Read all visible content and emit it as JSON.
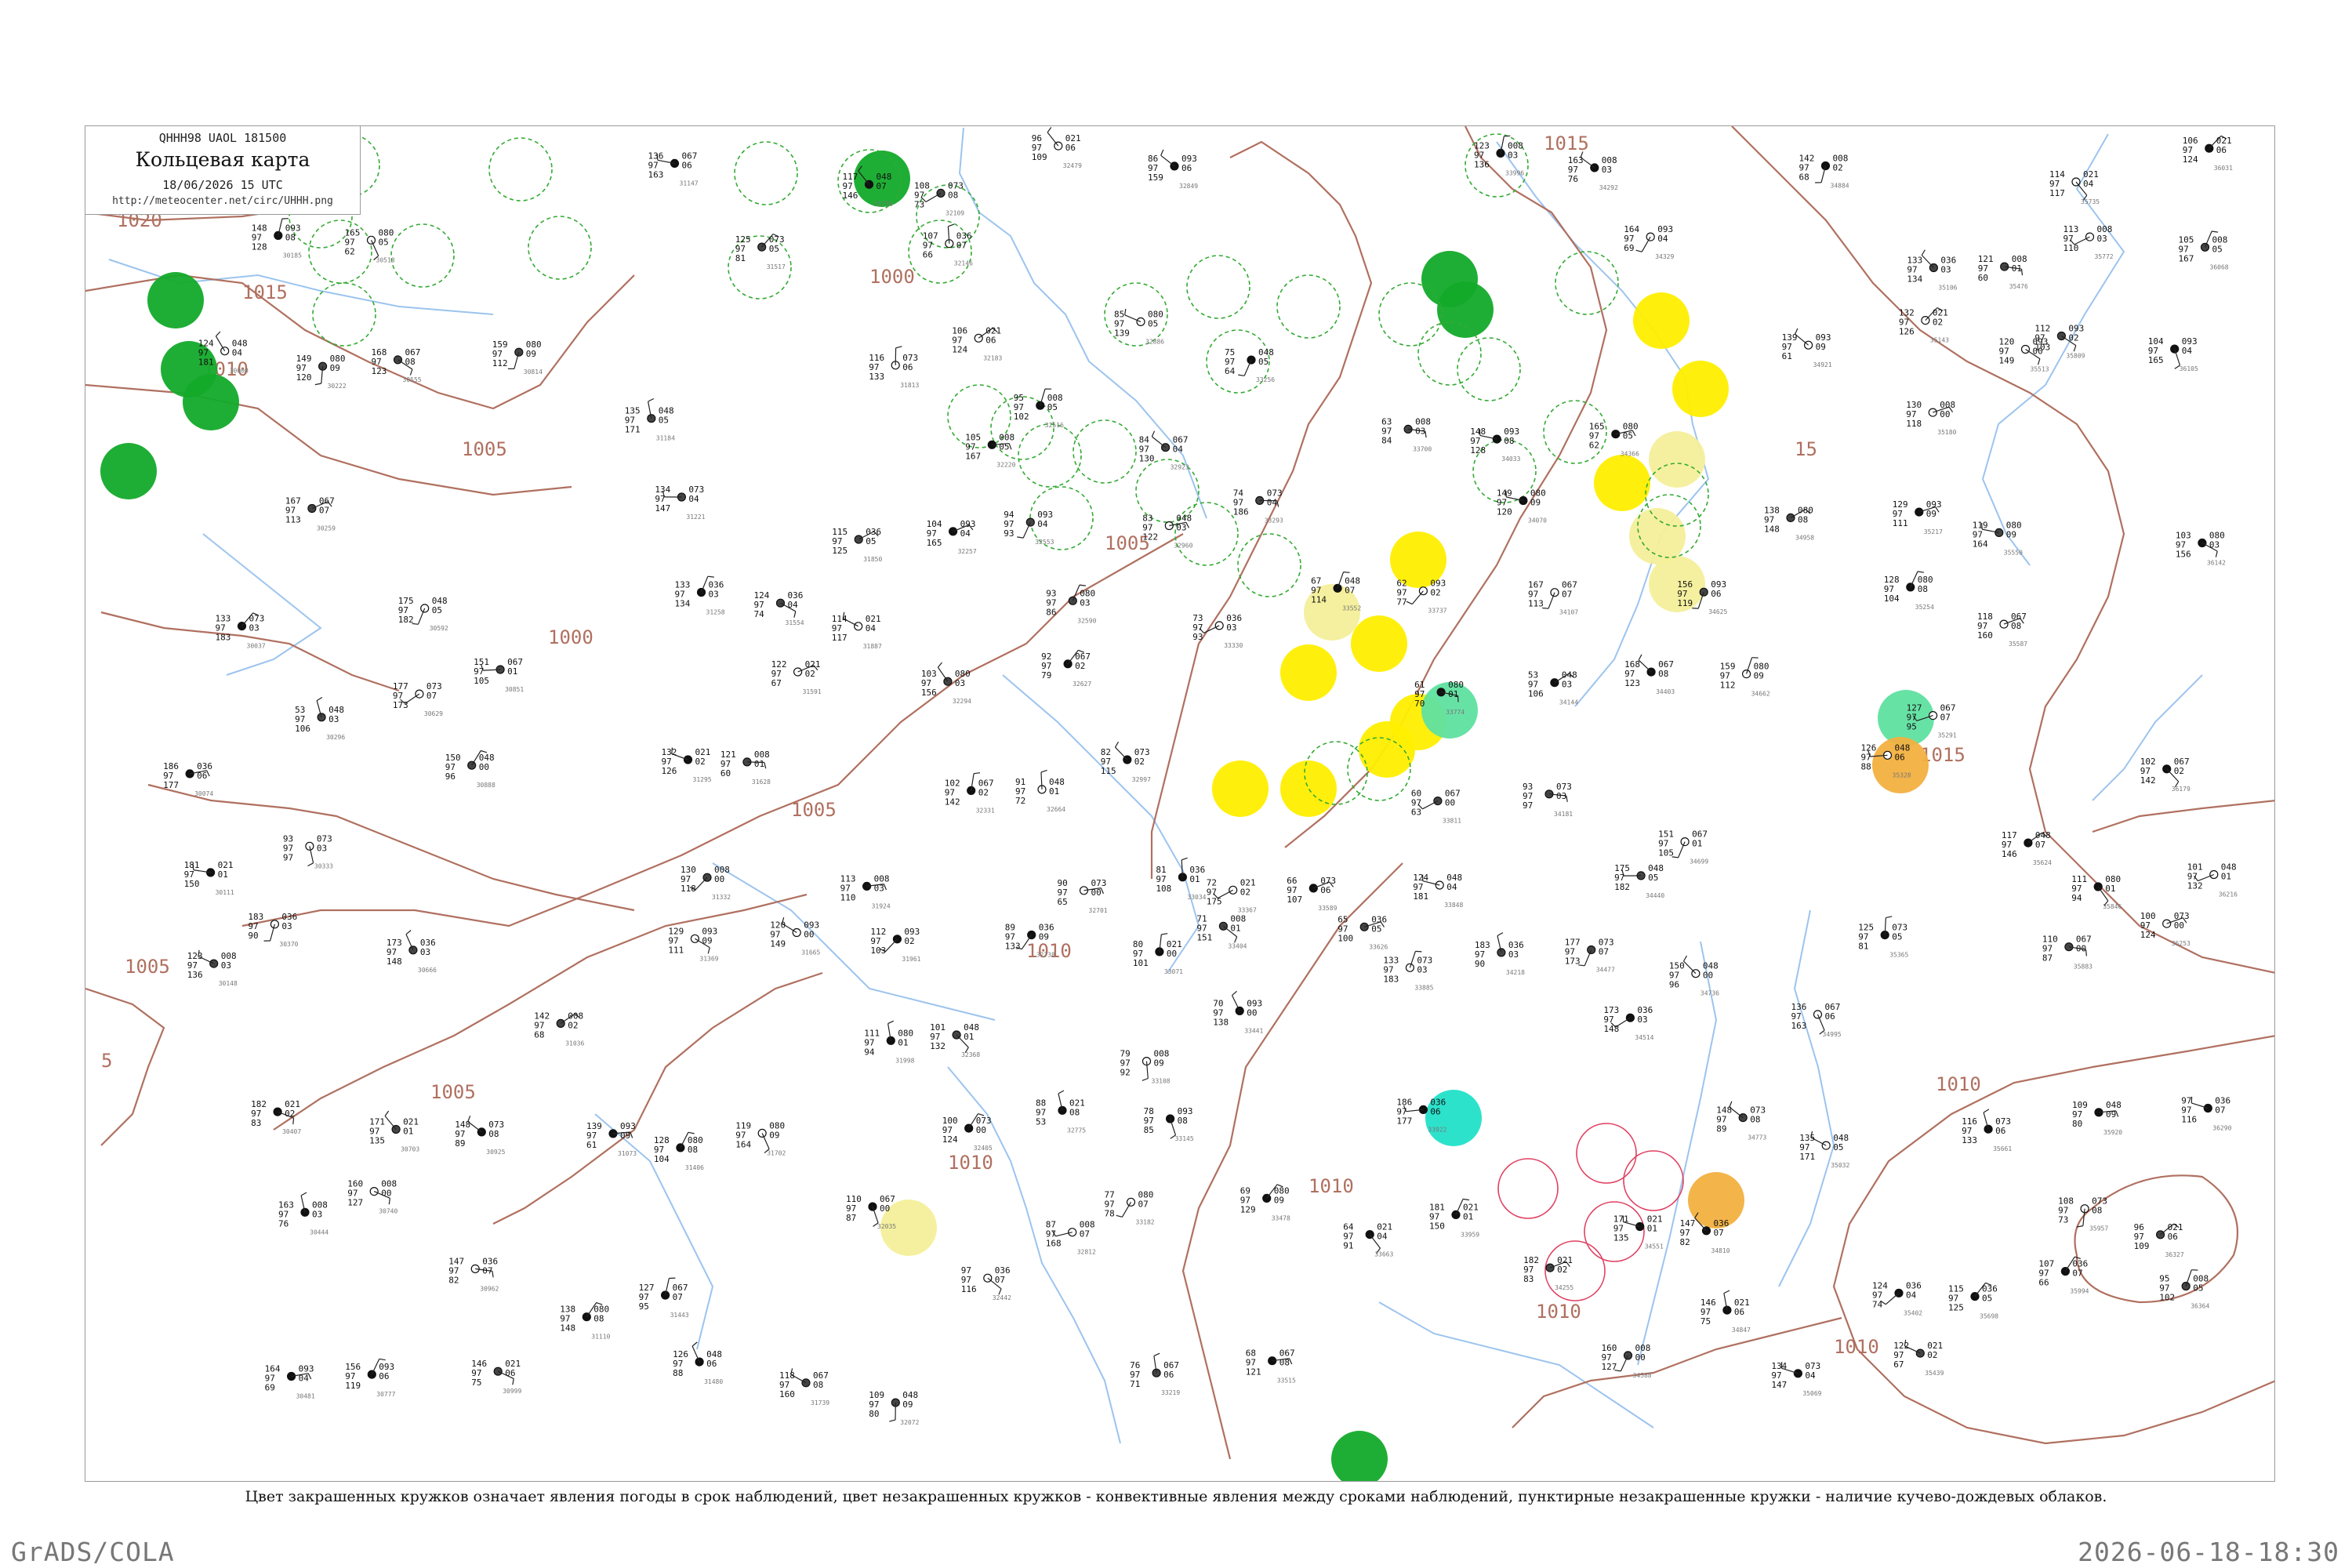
{
  "header": {
    "code": "QHHH98  UAOL  181500",
    "title": "Кольцевая карта",
    "datetime": "18/06/2026 15 UTC",
    "url": "http://meteocenter.net/circ/UHHH.png"
  },
  "caption": "Цвет закрашенных кружков означает явления погоды в срок наблюдений, цвет незакрашенных кружков - конвективные явления между сроками наблюдений, пунктирные незакрашенные кружки - наличие кучево-дождевых облаков.",
  "footer": {
    "left": "GrADS/COLA",
    "right": "2026-06-18-18:30"
  },
  "colors": {
    "isobar": "#b07060",
    "river": "#9cc4ee",
    "coast": "#6aa8e8",
    "cb_ring": "#33aa33",
    "shower_green": "#13aa2a",
    "light_yellow": "#f4ef9a",
    "yellow": "#ffee00",
    "mint": "#5fe0a0",
    "orange": "#f2b040",
    "cyan": "#22e0c8",
    "thunder_ring": "#e04060"
  },
  "isobar_labels": [
    {
      "text": "1020",
      "pos": "upper-left"
    },
    {
      "text": "1015",
      "pos": "upper-left"
    },
    {
      "text": "1010",
      "pos": "upper-left"
    },
    {
      "text": "1005",
      "pos": "left"
    },
    {
      "text": "1000",
      "pos": "upper-center"
    },
    {
      "text": "1000",
      "pos": "center-left"
    },
    {
      "text": "1005",
      "pos": "center"
    },
    {
      "text": "1005",
      "pos": "lower-left"
    },
    {
      "text": "1005",
      "pos": "far-left"
    },
    {
      "text": "1005",
      "pos": "lower-left"
    },
    {
      "text": "1010",
      "pos": "center"
    },
    {
      "text": "1010",
      "pos": "lower-center"
    },
    {
      "text": "1010",
      "pos": "center-right"
    },
    {
      "text": "1010",
      "pos": "right"
    },
    {
      "text": "1010",
      "pos": "lower-right"
    },
    {
      "text": "1010",
      "pos": "bottom-right"
    },
    {
      "text": "1015",
      "pos": "top-right"
    },
    {
      "text": "1015",
      "pos": "right"
    },
    {
      "text": "15",
      "pos": "right"
    },
    {
      "text": "5",
      "pos": "far-left"
    }
  ],
  "station_values": [
    "124",
    "133",
    "186",
    "181",
    "123",
    "148",
    "149",
    "167",
    "53",
    "93",
    "183",
    "182",
    "163",
    "164",
    "165",
    "168",
    "175",
    "177",
    "173",
    "171",
    "160",
    "156",
    "159",
    "151",
    "150",
    "148",
    "147",
    "146",
    "142",
    "139",
    "138",
    "136",
    "135",
    "134",
    "133",
    "132",
    "130",
    "129",
    "128",
    "127",
    "126",
    "125",
    "124",
    "122",
    "121",
    "120",
    "119",
    "118",
    "117",
    "116",
    "115",
    "114",
    "113",
    "112",
    "111",
    "110",
    "109",
    "108",
    "107",
    "106",
    "105",
    "104",
    "103",
    "102",
    "101",
    "100",
    "97",
    "96",
    "95",
    "94",
    "93",
    "92",
    "91",
    "90",
    "89",
    "88",
    "87",
    "86",
    "85",
    "84",
    "83",
    "82",
    "81",
    "80",
    "79",
    "78",
    "77",
    "76",
    "75",
    "74",
    "73",
    "72",
    "71",
    "70",
    "69",
    "68",
    "67",
    "66",
    "65",
    "64",
    "63",
    "62",
    "61",
    "60"
  ]
}
